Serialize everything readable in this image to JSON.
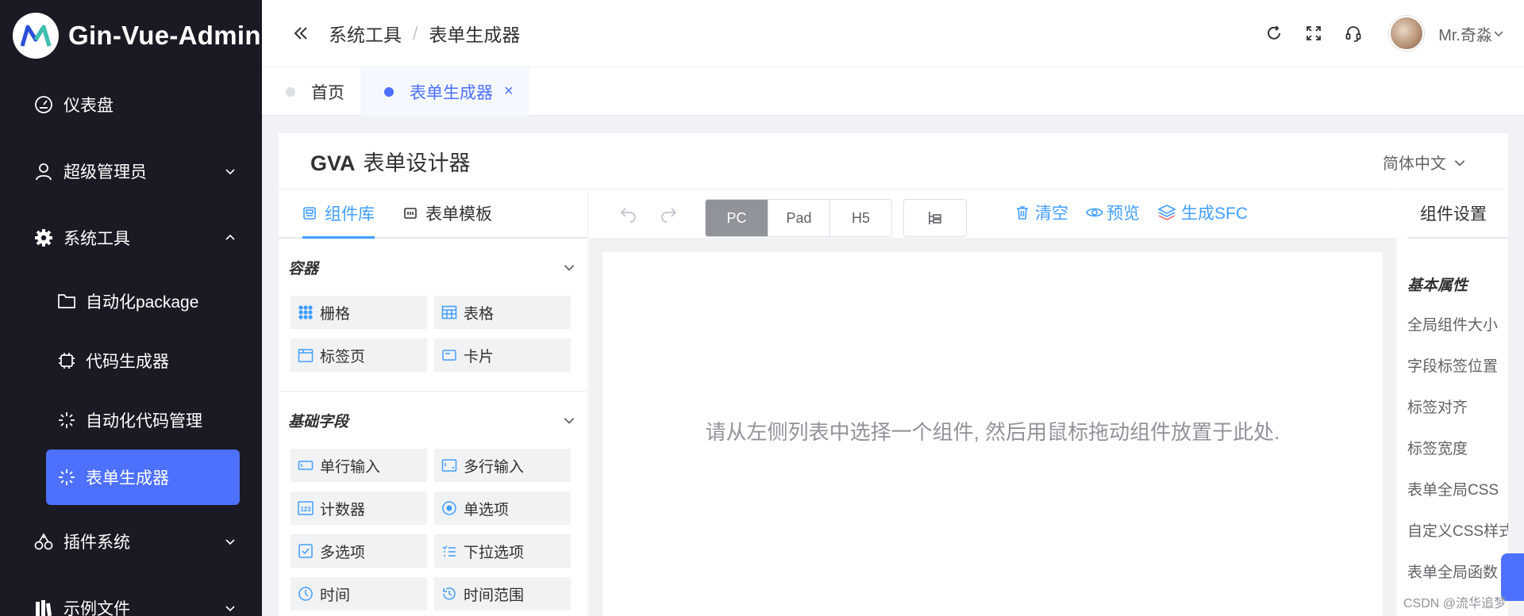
{
  "app": {
    "title": "Gin-Vue-Admin"
  },
  "sidebar": {
    "items": [
      {
        "label": "仪表盘",
        "icon": "dashboard-icon"
      },
      {
        "label": "超级管理员",
        "icon": "user-icon"
      },
      {
        "label": "系统工具",
        "icon": "gear-icon"
      },
      {
        "label": "插件系统",
        "icon": "cherry-icon"
      },
      {
        "label": "示例文件",
        "icon": "books-icon"
      }
    ],
    "sub_items": [
      {
        "label": "自动化package",
        "icon": "folder-icon"
      },
      {
        "label": "代码生成器",
        "icon": "chip-icon"
      },
      {
        "label": "自动化代码管理",
        "icon": "loading-icon"
      },
      {
        "label": "表单生成器",
        "icon": "loading-icon"
      }
    ]
  },
  "header": {
    "breadcrumb": [
      "系统工具",
      "表单生成器"
    ],
    "breadcrumb_sep": "/",
    "username": "Mr.奇淼"
  },
  "tabs": [
    {
      "label": "首页"
    },
    {
      "label": "表单生成器",
      "close": "×"
    }
  ],
  "designer": {
    "title_bold": "GVA",
    "title_rest": "表单设计器",
    "language": "简体中文",
    "left_tabs": [
      "组件库",
      "表单模板"
    ],
    "groups": [
      {
        "title": "容器",
        "components": [
          "栅格",
          "表格",
          "标签页",
          "卡片"
        ]
      },
      {
        "title": "基础字段",
        "components": [
          "单行输入",
          "多行输入",
          "计数器",
          "单选项",
          "多选项",
          "下拉选项",
          "时间",
          "时间范围"
        ]
      }
    ],
    "devices": [
      "PC",
      "Pad",
      "H5"
    ],
    "actions": [
      "清空",
      "预览",
      "生成SFC"
    ],
    "canvas_tip": "请从左侧列表中选择一个组件, 然后用鼠标拖动组件放置于此处.",
    "settings_tab": "组件设置",
    "settings_group": "基本属性",
    "settings_fields": [
      "全局组件大小",
      "字段标签位置",
      "标签对齐",
      "标签宽度",
      "表单全局CSS",
      "自定义CSS样式",
      "表单全局函数"
    ]
  },
  "watermark": "CSDN @流华追梦",
  "colors": {
    "primary": "#4d70ff",
    "link": "#409eff",
    "sidebar_bg": "#191a23"
  }
}
